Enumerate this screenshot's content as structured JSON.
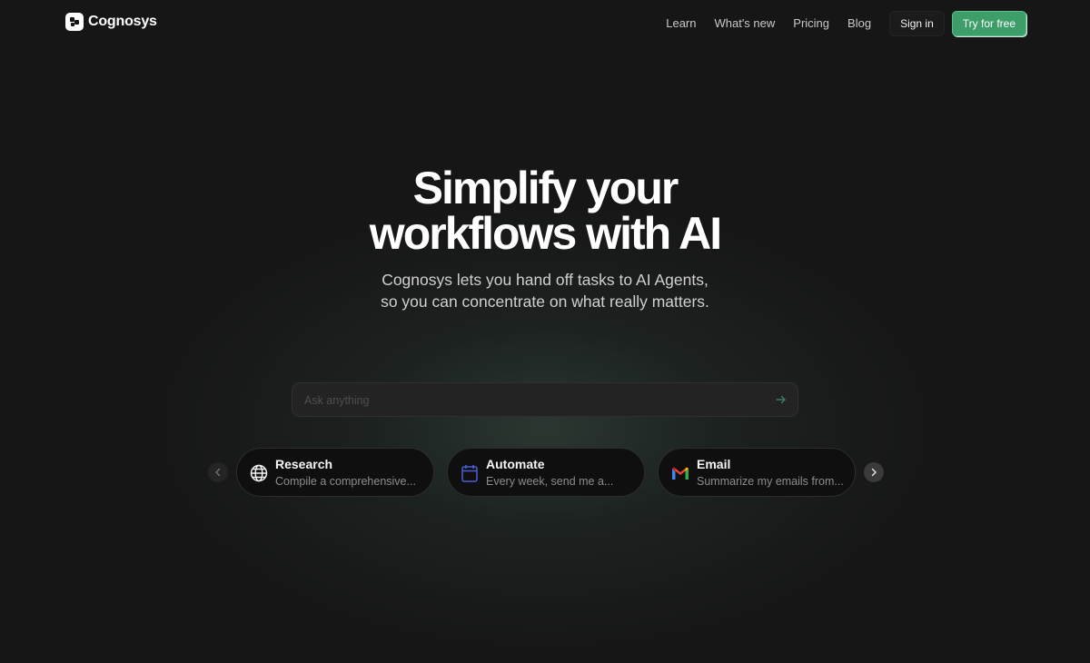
{
  "brand": {
    "name": "Cognosys",
    "accent": "#3d9e6a"
  },
  "nav": {
    "links": [
      "Learn",
      "What's new",
      "Pricing",
      "Blog"
    ],
    "sign_in": "Sign in",
    "cta": "Try for free"
  },
  "hero": {
    "title_line1": "Simplify your",
    "title_line2": "workflows with AI",
    "subtitle_line1": "Cognosys lets you hand off tasks to AI Agents,",
    "subtitle_line2": "so you can concentrate on what really matters."
  },
  "search": {
    "placeholder": "Ask anything",
    "value": "",
    "submit_icon": "arrow-right-icon"
  },
  "cards": [
    {
      "title": "Research",
      "description": "Compile a comprehensive...",
      "icon": "globe-icon"
    },
    {
      "title": "Automate",
      "description": "Every week, send me a...",
      "icon": "calendar-icon"
    },
    {
      "title": "Email",
      "description": "Summarize my emails from...",
      "icon": "gmail-icon"
    }
  ],
  "carousel": {
    "prev_icon": "chevron-left-icon",
    "next_icon": "chevron-right-icon"
  }
}
